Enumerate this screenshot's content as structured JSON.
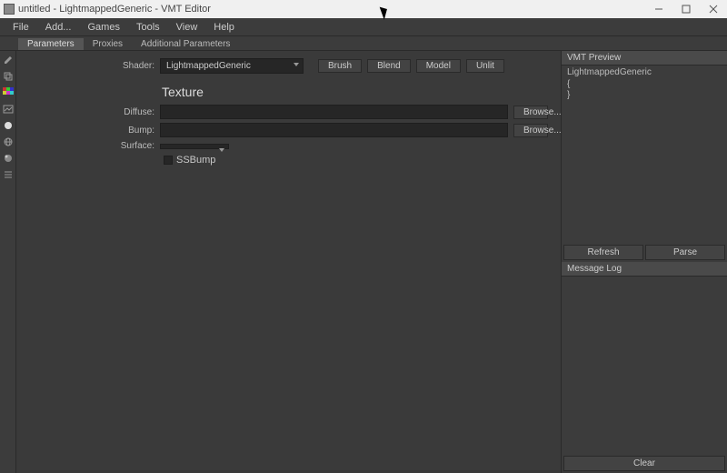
{
  "window": {
    "title": "untitled - LightmappedGeneric - VMT Editor"
  },
  "menubar": [
    "File",
    "Add...",
    "Games",
    "Tools",
    "View",
    "Help"
  ],
  "tabs": {
    "items": [
      "Parameters",
      "Proxies",
      "Additional Parameters"
    ],
    "activeIndex": 0
  },
  "form": {
    "shader_label": "Shader:",
    "shader_value": "LightmappedGeneric",
    "mode_buttons": [
      "Brush",
      "Blend",
      "Model",
      "Unlit"
    ],
    "section_title": "Texture",
    "diffuse_label": "Diffuse:",
    "diffuse_value": "",
    "bump_label": "Bump:",
    "bump_value": "",
    "browse_label": "Browse...",
    "surface_label": "Surface:",
    "surface_value": "",
    "ssbump_label": "SSBump",
    "ssbump_checked": false
  },
  "preview": {
    "panel_title": "VMT Preview",
    "line1": "LightmappedGeneric",
    "line2": "{",
    "line3": "}",
    "refresh_label": "Refresh",
    "parse_label": "Parse"
  },
  "log": {
    "panel_title": "Message Log",
    "clear_label": "Clear"
  },
  "icon_names": [
    "edit",
    "copy",
    "palette",
    "gallery",
    "circle",
    "globe",
    "sphere",
    "list"
  ]
}
